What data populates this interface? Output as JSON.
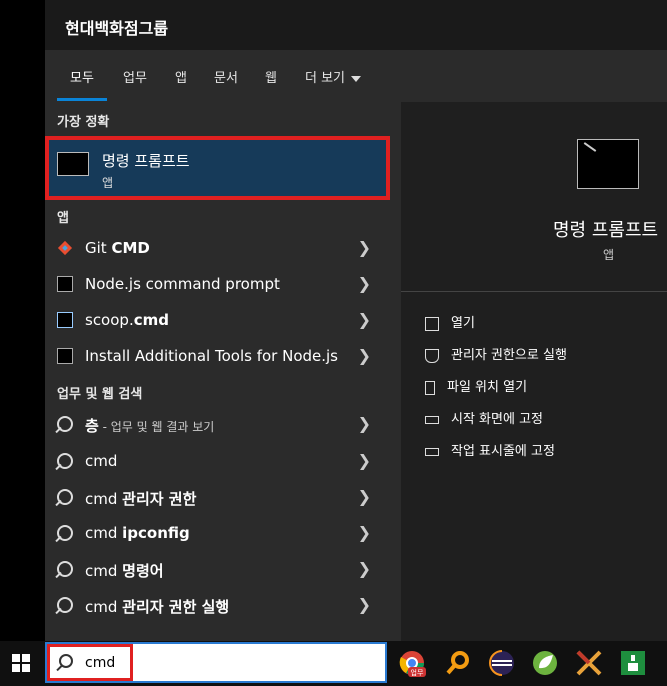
{
  "header": {
    "title": "현대백화점그룹"
  },
  "tabs": [
    {
      "label": "모두",
      "active": true
    },
    {
      "label": "업무"
    },
    {
      "label": "앱"
    },
    {
      "label": "문서"
    },
    {
      "label": "웹"
    },
    {
      "label": "더 보기"
    }
  ],
  "best_match": {
    "section_label": "가장 정확",
    "name": "명령 프롬프트",
    "kind": "앱"
  },
  "apps": {
    "section_label": "앱",
    "items": [
      {
        "prefix": "Git ",
        "bold": "CMD",
        "icon": "git-icon"
      },
      {
        "prefix": "Node.js command prompt",
        "bold": "",
        "icon": "terminal-icon"
      },
      {
        "prefix": "scoop.",
        "bold": "cmd",
        "icon": "script-icon"
      },
      {
        "prefix": "Install Additional Tools for Node.js",
        "bold": "",
        "icon": "terminal-icon"
      }
    ]
  },
  "web": {
    "section_label": "업무 및 웹 검색",
    "items": [
      {
        "bold": "층",
        "rest": " - 업무 및 웹 결과 보기"
      },
      {
        "bold": "cmd",
        "rest": ""
      },
      {
        "plain": "cmd ",
        "bold": "관리자 권한"
      },
      {
        "plain": "cmd ",
        "bold": "ipconfig"
      },
      {
        "plain": "cmd ",
        "bold": "명령어"
      },
      {
        "plain": "cmd ",
        "bold": "관리자 권한 실행"
      }
    ]
  },
  "preview": {
    "title": "명령 프롬프트",
    "subtitle": "앱",
    "actions": [
      {
        "label": "열기",
        "icon": "open-icon"
      },
      {
        "label": "관리자 권한으로 실행",
        "icon": "shield-icon"
      },
      {
        "label": "파일 위치 열기",
        "icon": "file-location-icon"
      },
      {
        "label": "시작 화면에 고정",
        "icon": "pin-icon"
      },
      {
        "label": "작업 표시줄에 고정",
        "icon": "pin-icon"
      }
    ]
  },
  "taskbar": {
    "search_value": "cmd",
    "icons": [
      "chrome-icon",
      "search-tool-icon",
      "eclipse-icon",
      "spring-icon",
      "tool-icon",
      "green-app-icon"
    ],
    "chrome_badge": "업무"
  }
}
